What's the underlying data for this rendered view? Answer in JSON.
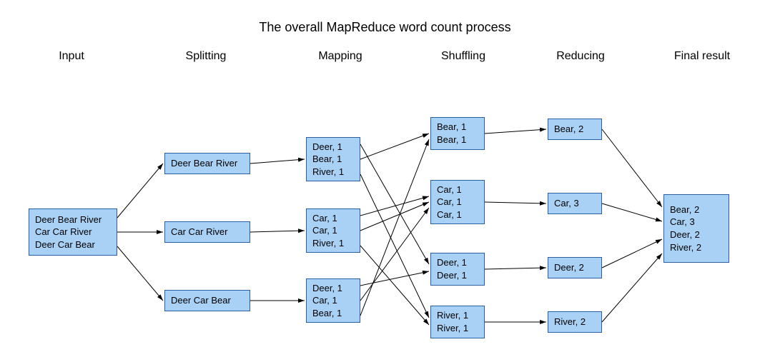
{
  "title": "The overall MapReduce word count process",
  "stages": {
    "input": "Input",
    "splitting": "Splitting",
    "mapping": "Mapping",
    "shuffling": "Shuffling",
    "reducing": "Reducing",
    "final": "Final result"
  },
  "nodes": {
    "input": "Deer Bear River\nCar Car River\nDeer Car Bear",
    "split1": "Deer Bear River",
    "split2": "Car Car River",
    "split3": "Deer Car Bear",
    "map1": "Deer, 1\nBear, 1\nRiver, 1",
    "map2": "Car, 1\nCar, 1\nRiver, 1",
    "map3": "Deer, 1\nCar, 1\nBear, 1",
    "shuf1": "Bear, 1\nBear, 1",
    "shuf2": "Car, 1\nCar, 1\nCar, 1",
    "shuf3": "Deer, 1\nDeer, 1",
    "shuf4": "River, 1\nRiver, 1",
    "red1": "Bear, 2",
    "red2": "Car, 3",
    "red3": "Deer, 2",
    "red4": "River, 2",
    "final": "Bear, 2\nCar, 3\nDeer, 2\nRiver, 2"
  }
}
